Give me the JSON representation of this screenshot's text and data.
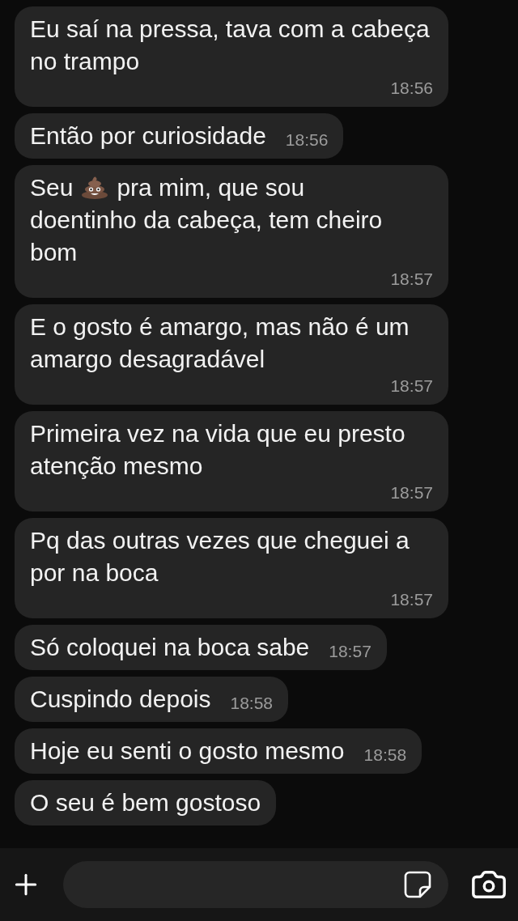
{
  "messages": [
    {
      "parts": [
        {
          "kind": "text",
          "text": "Eu saí na pressa, tava com a cabeça no trampo"
        }
      ],
      "time": "18:56"
    },
    {
      "parts": [
        {
          "kind": "text",
          "text": "Então por curiosidade"
        }
      ],
      "time": "18:56"
    },
    {
      "parts": [
        {
          "kind": "word",
          "text": "Seu"
        },
        {
          "kind": "emoji"
        },
        {
          "kind": "word",
          "text": "pra mim, que sou"
        },
        {
          "kind": "text",
          "text": "doentinho da cabeça, tem cheiro bom"
        }
      ],
      "time": "18:57"
    },
    {
      "parts": [
        {
          "kind": "text",
          "text": "E o gosto é amargo, mas não é um amargo desagradável"
        }
      ],
      "time": "18:57"
    },
    {
      "parts": [
        {
          "kind": "text",
          "text": "Primeira vez na vida que eu presto atenção mesmo"
        }
      ],
      "time": "18:57"
    },
    {
      "parts": [
        {
          "kind": "text",
          "text": "Pq das outras vezes que cheguei a por na boca"
        }
      ],
      "time": "18:57"
    },
    {
      "parts": [
        {
          "kind": "text",
          "text": "Só coloquei na boca sabe"
        }
      ],
      "time": "18:57"
    },
    {
      "parts": [
        {
          "kind": "text",
          "text": "Cuspindo depois"
        }
      ],
      "time": "18:58"
    },
    {
      "parts": [
        {
          "kind": "text",
          "text": "Hoje eu senti o gosto mesmo"
        }
      ],
      "time": "18:58"
    },
    {
      "parts": [
        {
          "kind": "text",
          "text": "O seu é bem gostoso"
        }
      ]
    }
  ]
}
